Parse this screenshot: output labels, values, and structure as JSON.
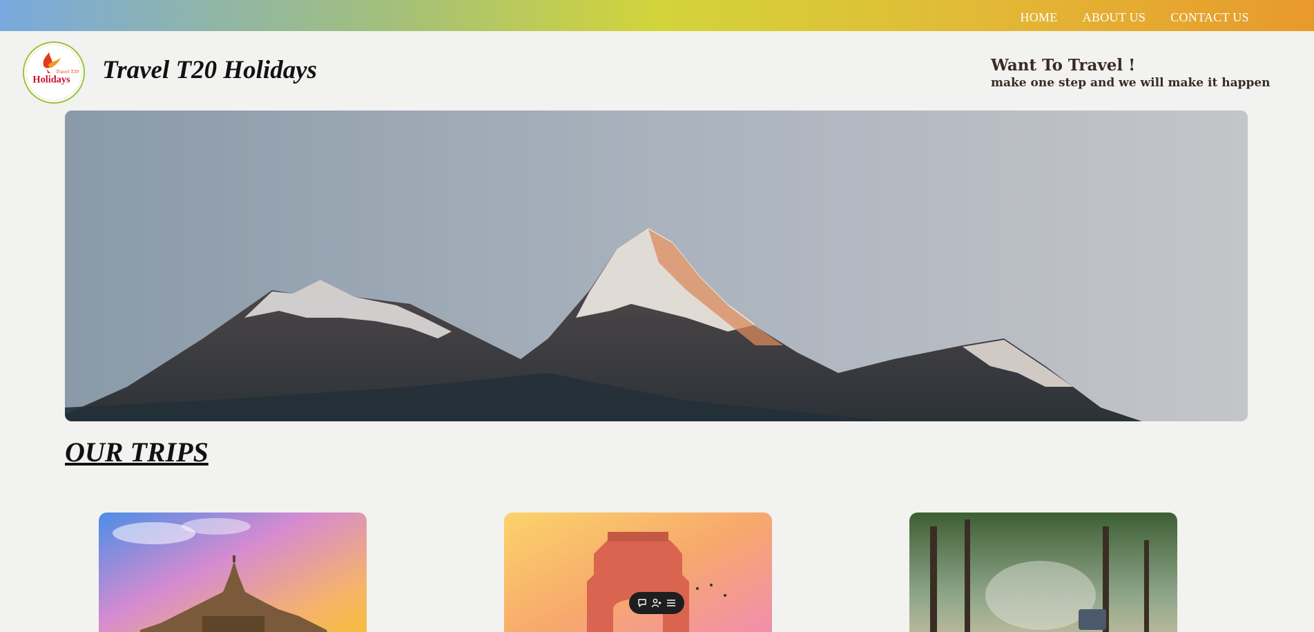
{
  "nav": {
    "items": [
      {
        "label": "HOME"
      },
      {
        "label": "ABOUT US"
      },
      {
        "label": "CONTACT US"
      }
    ]
  },
  "header": {
    "logo_text": "Holidays",
    "logo_subtext": "Travel T20",
    "title": "Travel T20 Holidays",
    "tagline_title": "Want To Travel !",
    "tagline_subtitle": "make one step and we will make it happen"
  },
  "sections": {
    "trips_title": "OUR TRIPS"
  },
  "trips": [
    {
      "image": "temple-photo"
    },
    {
      "image": "india-gate-photo"
    },
    {
      "image": "forest-safari-photo"
    }
  ],
  "floating_toolbar": {
    "icons": [
      "comment-icon",
      "add-user-icon",
      "menu-icon"
    ]
  },
  "colors": {
    "nav_gradient_start": "#79a9de",
    "nav_gradient_mid": "#d3d43a",
    "nav_gradient_end": "#e8992b",
    "page_background": "#f2f2f0",
    "logo_border": "#9bc23a",
    "tagline_text": "#3a2a25"
  }
}
